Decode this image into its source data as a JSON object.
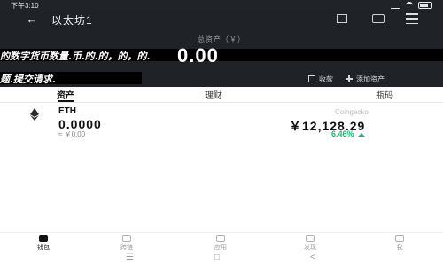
{
  "status_bar": {
    "time": "下午3:10"
  },
  "header": {
    "title": "以太坊1",
    "total_label": "总资产（￥）",
    "total_value": "0.00",
    "banner_line_1": "的数字货币数量.币.的.的，的，的.",
    "banner_line_2": "题.提交请求.",
    "receive_label": "收款",
    "add_label": "添加资产",
    "icons": {
      "back": "back-arrow-icon",
      "qr": "qr-icon",
      "tag": "tag-icon",
      "menu": "menu-icon"
    },
    "colors": {
      "background": "#1f2327",
      "text": "#ffffff"
    }
  },
  "tabs": [
    {
      "label": "资产"
    },
    {
      "label": "理财"
    },
    {
      "label": "瓶码"
    }
  ],
  "assets": [
    {
      "symbol": "ETH",
      "balance": "0.0000",
      "fiat_value": "≈ ￥0.00",
      "price_source": "Coingecko",
      "price": "￥12,128.29",
      "change": "6.46%",
      "icon": "ethereum-icon"
    }
  ],
  "bottom_nav": [
    {
      "label": "钱包",
      "icon": "wallet-icon"
    },
    {
      "label": "跨链",
      "icon": "infinity-icon"
    },
    {
      "label": "应用",
      "icon": "apps-icon"
    },
    {
      "label": "发现",
      "icon": "discover-icon"
    },
    {
      "label": "我",
      "icon": "profile-icon"
    }
  ],
  "android_nav": {
    "menu": "☰",
    "home": "□",
    "back": "<"
  },
  "colors": {
    "accent_green": "#1db874"
  }
}
